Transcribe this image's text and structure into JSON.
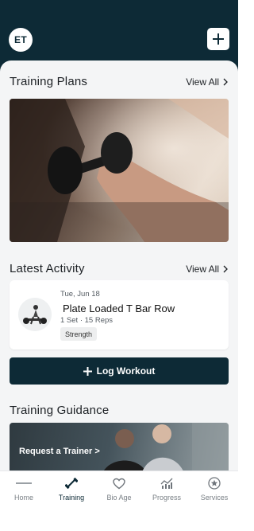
{
  "header": {
    "avatar_initials": "ET",
    "add_icon": "plus-icon"
  },
  "training_plans": {
    "title": "Training Plans",
    "view_all": "View All"
  },
  "latest_activity": {
    "title": "Latest Activity",
    "view_all": "View All",
    "card": {
      "date": "Tue, Jun 18",
      "title": "Plate Loaded T Bar Row",
      "meta": "1 Set · 15 Reps",
      "tag": "Strength"
    }
  },
  "log_workout": {
    "label": "Log Workout"
  },
  "training_guidance": {
    "title": "Training Guidance",
    "request_trainer": "Request a Trainer >"
  },
  "bottom_nav": {
    "items": [
      {
        "label": "Home",
        "icon": "logo-icon",
        "active": false
      },
      {
        "label": "Training",
        "icon": "dumbbell-icon",
        "active": true
      },
      {
        "label": "Bio Age",
        "icon": "heart-icon",
        "active": false
      },
      {
        "label": "Progress",
        "icon": "chart-icon",
        "active": false
      },
      {
        "label": "Services",
        "icon": "star-icon",
        "active": false
      }
    ]
  },
  "colors": {
    "brand_dark": "#0d2a36",
    "background": "#f4f5f6"
  }
}
